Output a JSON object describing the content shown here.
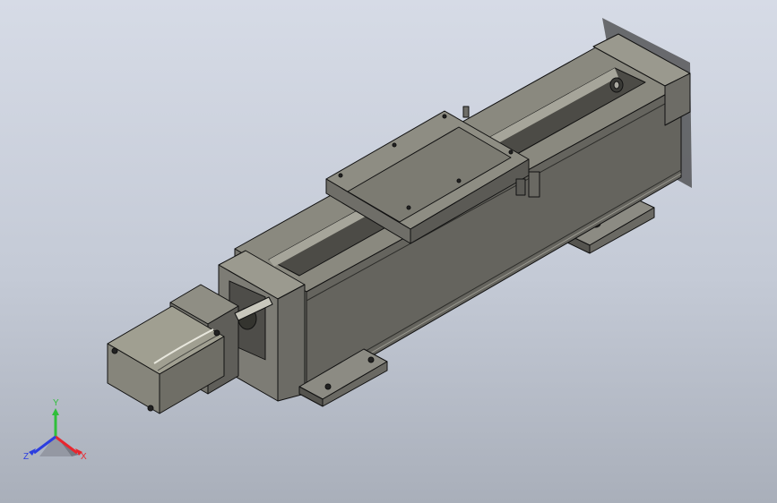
{
  "triad": {
    "x_label": "X",
    "y_label": "Y",
    "z_label": "Z",
    "colors": {
      "x": "#e8262e",
      "y": "#2fbf3a",
      "z": "#2c3ee0"
    }
  },
  "model": {
    "body_color": "#6e6d67",
    "motor_color": "#88877b",
    "edge_color": "#111111"
  }
}
